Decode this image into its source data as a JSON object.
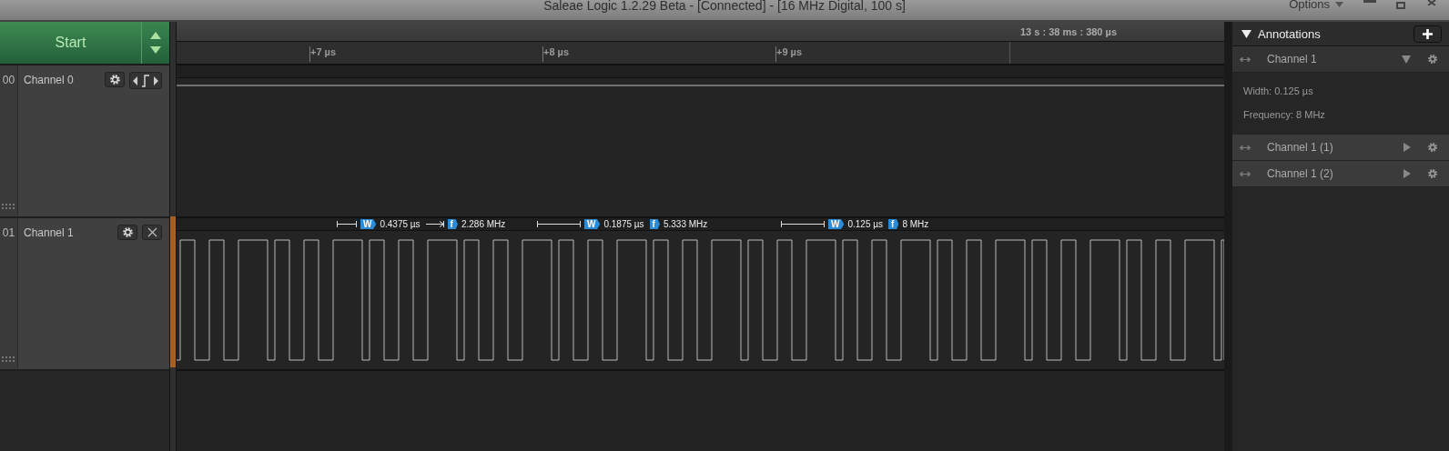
{
  "window": {
    "title": "Saleae Logic 1.2.29 Beta - [Connected] - [16 MHz Digital, 100 s]",
    "options_menu": "Options"
  },
  "start_button": {
    "label": "Start"
  },
  "timeline": {
    "cursor_time": "13 s : 38 ms : 380 µs",
    "ticks": [
      "+7 µs",
      "+8 µs",
      "+9 µs"
    ]
  },
  "channels": [
    {
      "number": "00",
      "name": "Channel 0",
      "kind": "trigger"
    },
    {
      "number": "01",
      "name": "Channel 1",
      "kind": "removable",
      "measurements": [
        {
          "width_tag": "W",
          "width": "0.4375 µs",
          "frequency_tag": "f",
          "frequency": "2.286 MHz"
        },
        {
          "width_tag": "W",
          "width": "0.1875 µs",
          "frequency_tag": "f",
          "frequency": "5.333 MHz"
        },
        {
          "width_tag": "W",
          "width": "0.125 µs",
          "frequency_tag": "f",
          "frequency": "8 MHz"
        }
      ]
    }
  ],
  "annotations": {
    "title": "Annotations",
    "items": [
      {
        "name": "Channel 1",
        "expanded": true,
        "details": [
          "Width: 0.125 µs",
          "Frequency: 8 MHz"
        ]
      },
      {
        "name": "Channel 1 (1)",
        "expanded": false
      },
      {
        "name": "Channel 1 (2)",
        "expanded": false
      }
    ]
  }
}
